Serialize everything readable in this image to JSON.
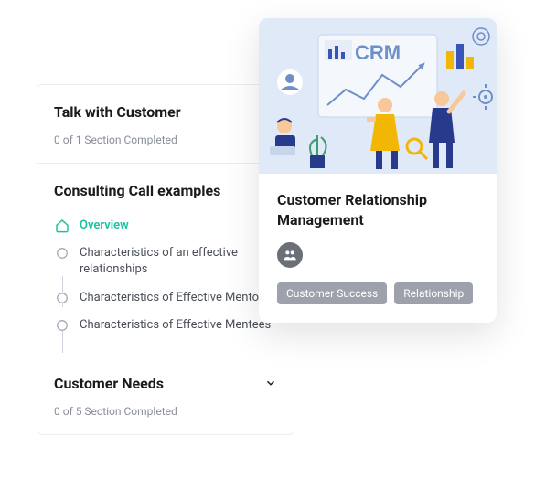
{
  "left_panel": {
    "sections": [
      {
        "title": "Talk with Customer",
        "status": "0 of 1 Section Completed",
        "expanded": false
      },
      {
        "title": "Consulting Call examples",
        "expanded": true,
        "items": [
          {
            "label": "Overview",
            "active": true,
            "icon": "home"
          },
          {
            "label": "Characteristics of an effective relationships",
            "active": false,
            "icon": "circle"
          },
          {
            "label": "Characteristics of Effective Mentors",
            "active": false,
            "icon": "circle"
          },
          {
            "label": "Characteristics of Effective Mentees",
            "active": false,
            "icon": "circle"
          }
        ]
      },
      {
        "title": "Customer Needs",
        "status": "0 of 5 Section Completed",
        "expanded": false
      }
    ]
  },
  "card": {
    "illustration_heading": "CRM",
    "title": "Customer Relationship Management",
    "badge_icon": "people",
    "tags": [
      "Customer Success",
      "Relationship"
    ]
  },
  "colors": {
    "accent": "#1cc29f",
    "tag_bg": "#9ca1ab",
    "badge_bg": "#6b6f78",
    "illustration_bg": "#dfe9f7"
  }
}
